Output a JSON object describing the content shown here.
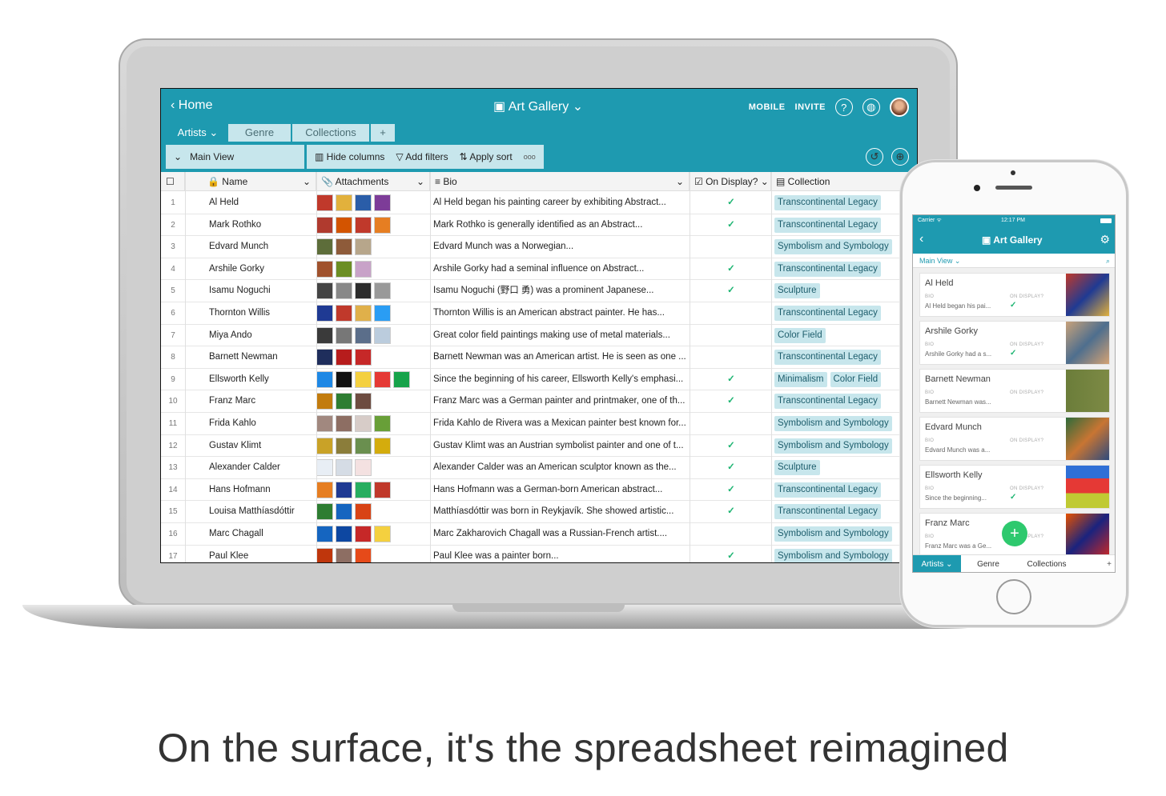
{
  "caption": "On the surface, it's the spreadsheet reimagined",
  "laptop": {
    "home": "Home",
    "title": "Art Gallery",
    "mobile": "MOBILE",
    "invite": "INVITE",
    "tabs": {
      "artists": "Artists",
      "genre": "Genre",
      "collections": "Collections",
      "add": "+"
    },
    "view": {
      "name": "Main View",
      "hide": "Hide columns",
      "filters": "Add filters",
      "sort": "Apply sort",
      "more": "ooo"
    },
    "headers": {
      "name": "Name",
      "attachments": "Attachments",
      "bio": "Bio",
      "display": "On Display?",
      "collection": "Collection"
    },
    "rows": [
      {
        "n": "1",
        "name": "Al Held",
        "bio": "Al Held began his painting career by exhibiting Abstract...",
        "disp": "✓",
        "coll": [
          "Transcontinental Legacy"
        ]
      },
      {
        "n": "2",
        "name": "Mark Rothko",
        "bio": "Mark Rothko is generally identified as an Abstract...",
        "disp": "✓",
        "coll": [
          "Transcontinental Legacy"
        ]
      },
      {
        "n": "3",
        "name": "Edvard Munch",
        "bio": "Edvard Munch was a Norwegian...",
        "disp": "",
        "coll": [
          "Symbolism and Symbology"
        ]
      },
      {
        "n": "4",
        "name": "Arshile Gorky",
        "bio": "Arshile Gorky had a seminal influence on Abstract...",
        "disp": "✓",
        "coll": [
          "Transcontinental Legacy"
        ]
      },
      {
        "n": "5",
        "name": "Isamu Noguchi",
        "bio": "Isamu Noguchi (野口 勇) was a prominent Japanese...",
        "disp": "✓",
        "coll": [
          "Sculpture"
        ]
      },
      {
        "n": "6",
        "name": "Thornton Willis",
        "bio": "Thornton Willis is an American abstract painter. He has...",
        "disp": "",
        "coll": [
          "Transcontinental Legacy"
        ]
      },
      {
        "n": "7",
        "name": "Miya Ando",
        "bio": "Great color field paintings making use of metal materials...",
        "disp": "",
        "coll": [
          "Color Field"
        ]
      },
      {
        "n": "8",
        "name": "Barnett Newman",
        "bio": "Barnett Newman was an American artist. He is seen as one ...",
        "disp": "",
        "coll": [
          "Transcontinental Legacy"
        ]
      },
      {
        "n": "9",
        "name": "Ellsworth Kelly",
        "bio": "Since the beginning of his career, Ellsworth Kelly's emphasi...",
        "disp": "✓",
        "coll": [
          "Minimalism",
          "Color Field"
        ]
      },
      {
        "n": "10",
        "name": "Franz Marc",
        "bio": "Franz Marc was a German painter and printmaker, one of th...",
        "disp": "✓",
        "coll": [
          "Transcontinental Legacy"
        ]
      },
      {
        "n": "11",
        "name": "Frida Kahlo",
        "bio": "Frida Kahlo de Rivera was a Mexican painter best known for...",
        "disp": "",
        "coll": [
          "Symbolism and Symbology"
        ]
      },
      {
        "n": "12",
        "name": "Gustav Klimt",
        "bio": "Gustav Klimt was an Austrian symbolist painter and one of t...",
        "disp": "✓",
        "coll": [
          "Symbolism and Symbology"
        ]
      },
      {
        "n": "13",
        "name": "Alexander Calder",
        "bio": "Alexander Calder was an American sculptor known as the...",
        "disp": "✓",
        "coll": [
          "Sculpture"
        ]
      },
      {
        "n": "14",
        "name": "Hans Hofmann",
        "bio": "Hans Hofmann was a German-born American abstract...",
        "disp": "✓",
        "coll": [
          "Transcontinental Legacy"
        ]
      },
      {
        "n": "15",
        "name": "Louisa Matthíasdóttir",
        "bio": "Matthíasdóttir was born in Reykjavík. She showed artistic...",
        "disp": "✓",
        "coll": [
          "Transcontinental Legacy"
        ]
      },
      {
        "n": "16",
        "name": "Marc Chagall",
        "bio": "Marc Zakharovich Chagall was a Russian-French artist....",
        "disp": "",
        "coll": [
          "Symbolism and Symbology"
        ]
      },
      {
        "n": "17",
        "name": "Paul Klee",
        "bio": "Paul Klee was a painter born...",
        "disp": "✓",
        "coll": [
          "Symbolism and Symbology"
        ]
      }
    ]
  },
  "phone": {
    "carrier": "Carrier",
    "time": "12:17 PM",
    "title": "Art Gallery",
    "view": "Main View",
    "bio_label": "BIO",
    "display_label": "ON DISPLAY?",
    "cards": [
      {
        "name": "Al Held",
        "snip": "Al Held began his pai...",
        "check": "✓"
      },
      {
        "name": "Arshile Gorky",
        "snip": "Arshile Gorky had a s...",
        "check": "✓"
      },
      {
        "name": "Barnett Newman",
        "snip": "Barnett Newman was...",
        "check": ""
      },
      {
        "name": "Edvard Munch",
        "snip": "Edvard Munch was a...",
        "check": ""
      },
      {
        "name": "Ellsworth Kelly",
        "snip": "Since the beginning...",
        "check": "✓"
      },
      {
        "name": "Franz Marc",
        "snip": "Franz Marc was a Ge...",
        "check": ""
      }
    ],
    "tabs": {
      "artists": "Artists",
      "genre": "Genre",
      "collections": "Collections",
      "add": "+"
    }
  },
  "colors": {
    "accent": "#1e9ab0",
    "pill": "#c7e6ec",
    "check": "#1fb573"
  }
}
